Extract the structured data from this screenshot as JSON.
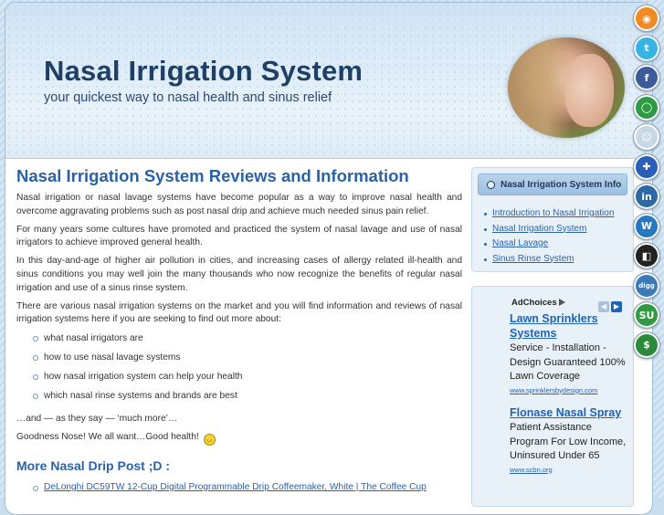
{
  "header": {
    "title": "Nasal Irrigation System",
    "tagline": "your quickest way to nasal health and sinus relief"
  },
  "social_icons": [
    {
      "name": "rss-icon",
      "color": "#f08a24",
      "glyph": "◉"
    },
    {
      "name": "twitter-icon",
      "color": "#37b4e6",
      "glyph": "t"
    },
    {
      "name": "facebook-icon",
      "color": "#3b5b9a",
      "glyph": "f"
    },
    {
      "name": "orkut-icon",
      "color": "#2f9a44",
      "glyph": "◯"
    },
    {
      "name": "reddit-icon",
      "color": "#c9d8e6",
      "glyph": "☺"
    },
    {
      "name": "myspace-icon",
      "color": "#2a5fb8",
      "glyph": "✚"
    },
    {
      "name": "linkedin-icon",
      "color": "#2c6aa5",
      "glyph": "in"
    },
    {
      "name": "wordpress-icon",
      "color": "#2778c0",
      "glyph": "W"
    },
    {
      "name": "delicious-icon",
      "color": "#222222",
      "glyph": "◧"
    },
    {
      "name": "digg-icon",
      "color": "#3a7ab8",
      "glyph": "digg"
    },
    {
      "name": "stumbleupon-icon",
      "color": "#2f9a3f",
      "glyph": "SU"
    },
    {
      "name": "money-icon",
      "color": "#2a8a3a",
      "glyph": "$"
    }
  ],
  "main": {
    "post_title": "Nasal Irrigation System Reviews and Information",
    "paragraphs": [
      "Nasal irrigation or nasal lavage systems have become popular as a way to improve nasal health and overcome aggravating problems such as post nasal drip and achieve much needed sinus pain relief.",
      "For many years some cultures have promoted and practiced the system of nasal lavage and use of nasal irrigators to achieve improved general health.",
      "In this day-and-age of higher air pollution in cities, and increasing cases of allergy related ill-health and sinus conditions you may well join the many thousands who now recognize the benefits of regular nasal irrigation and use of a sinus rinse system.",
      "There are various nasal irrigation systems on the market and you will find information and reviews of nasal irrigation systems here if you are seeking to find out more about:"
    ],
    "bullets": [
      "what nasal irrigators are",
      "how to use nasal lavage systems",
      "how nasal irrigation system can help your health",
      "which nasal rinse systems and brands are best"
    ],
    "after_bullets": "…and — as they say — ‘much more’…",
    "closing": "Goodness Nose! We all want…Good health!",
    "more_title": "More Nasal Drip Post ;D :",
    "more_links": [
      "DeLonghi DC59TW 12-Cup Digital Programmable Drip Coffeemaker, White | The Coffee Cup"
    ]
  },
  "sidebar": {
    "info_title": "Nasal Irrigation System Info",
    "links": [
      "Introduction to Nasal Irrigation",
      "Nasal Irrigation System",
      "Nasal Lavage",
      "Sinus Rinse System"
    ],
    "adchoices": "AdChoices",
    "ads": [
      {
        "title": "Lawn Sprinklers Systems",
        "body": "Service - Installation - Design Guaranteed 100% Lawn Coverage",
        "url": "www.sprinklersbydesign.com"
      },
      {
        "title": "Flonase Nasal Spray",
        "body": "Patient Assistance Program For Low Income, Uninsured Under 65",
        "url": "www.scbn.org"
      }
    ]
  }
}
